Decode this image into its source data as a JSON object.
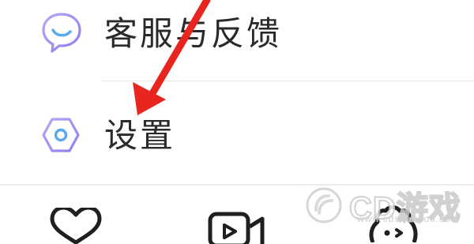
{
  "menu": {
    "items": [
      {
        "label": "客服与反馈",
        "icon": "chat-bubble-icon"
      },
      {
        "label": "设置",
        "icon": "hexagon-settings-icon"
      }
    ]
  },
  "tabbar": {
    "items": [
      {
        "icon": "heart-icon"
      },
      {
        "icon": "video-camera-icon"
      },
      {
        "icon": "creator-face-icon"
      }
    ]
  },
  "annotation": {
    "icon": "red-arrow-icon",
    "color": "#e8261f"
  },
  "watermark": {
    "text": "CD游戏",
    "url": "www.cdshouyou.com"
  },
  "colors": {
    "accent_purple": "#9a8cf0",
    "accent_blue": "#5aa9ee",
    "text": "#2a2a2a",
    "divider": "#e6e6e6"
  }
}
